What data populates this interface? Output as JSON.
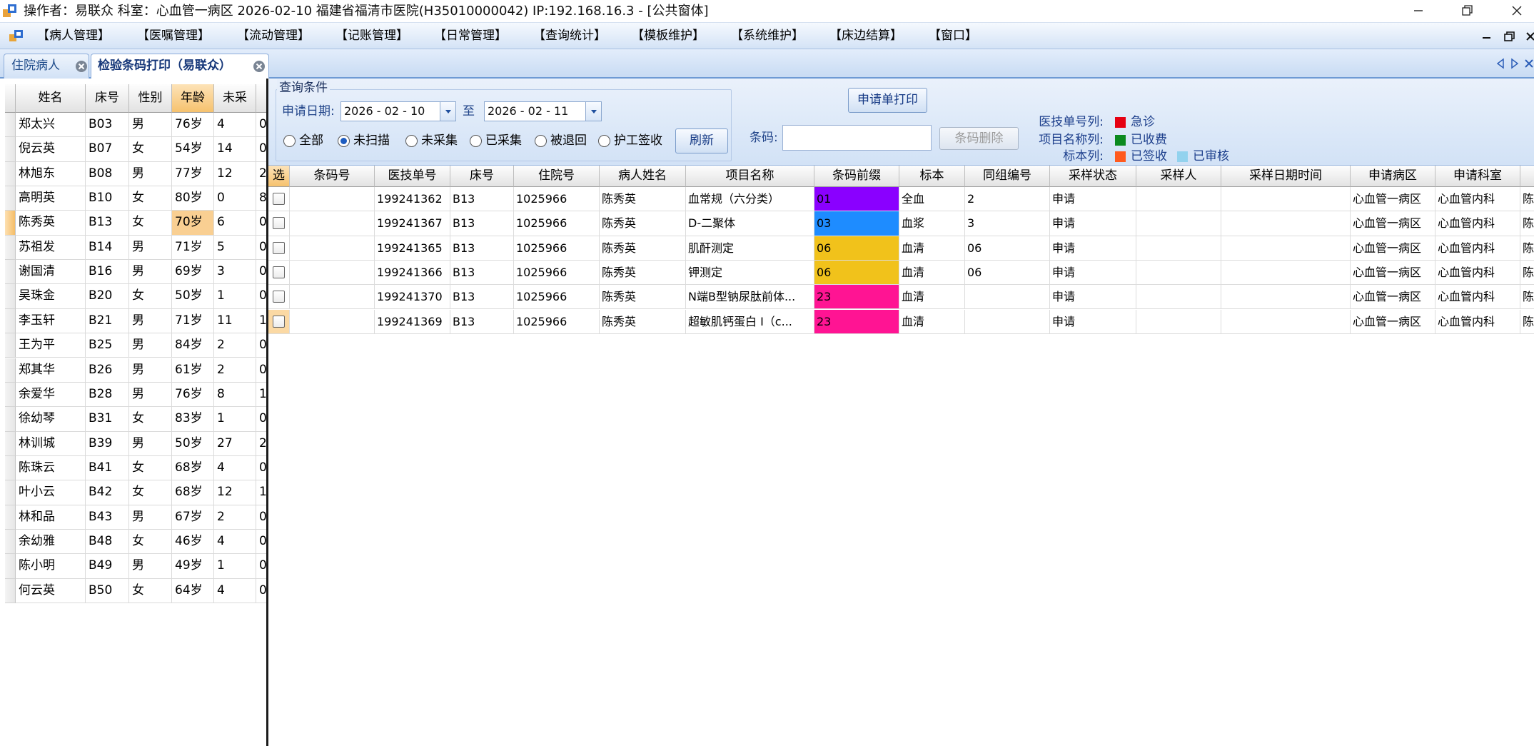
{
  "title_bar": {
    "text": "操作者：易联众  科室：心血管一病区  2026-02-10  福建省福清市医院(H35010000042) IP:192.168.16.3 - [公共窗体]"
  },
  "menu": {
    "items": [
      "【病人管理】",
      "【医嘱管理】",
      "【流动管理】",
      "【记账管理】",
      "【日常管理】",
      "【查询统计】",
      "【模板维护】",
      "【系统维护】",
      "【床边结算】",
      "【窗口】"
    ]
  },
  "tabs": [
    {
      "label": "住院病人",
      "active": false
    },
    {
      "label": "检验条码打印（易联众）",
      "active": true
    }
  ],
  "patient_list": {
    "columns": [
      "姓名",
      "床号",
      "性别",
      "年龄",
      "未采",
      ""
    ],
    "selected_index": 4,
    "rows": [
      {
        "name": "郑太兴",
        "bed": "B03",
        "sex": "男",
        "age": "76岁",
        "pending": "4",
        "extra": "0"
      },
      {
        "name": "倪云英",
        "bed": "B07",
        "sex": "女",
        "age": "54岁",
        "pending": "14",
        "extra": "0"
      },
      {
        "name": "林旭东",
        "bed": "B08",
        "sex": "男",
        "age": "77岁",
        "pending": "12",
        "extra": "2"
      },
      {
        "name": "高明英",
        "bed": "B10",
        "sex": "女",
        "age": "80岁",
        "pending": "0",
        "extra": "8"
      },
      {
        "name": "陈秀英",
        "bed": "B13",
        "sex": "女",
        "age": "70岁",
        "pending": "6",
        "extra": "0"
      },
      {
        "name": "苏祖发",
        "bed": "B14",
        "sex": "男",
        "age": "71岁",
        "pending": "5",
        "extra": "0"
      },
      {
        "name": "谢国清",
        "bed": "B16",
        "sex": "男",
        "age": "69岁",
        "pending": "3",
        "extra": "0"
      },
      {
        "name": "吴珠金",
        "bed": "B20",
        "sex": "女",
        "age": "50岁",
        "pending": "1",
        "extra": "0"
      },
      {
        "name": "李玉轩",
        "bed": "B21",
        "sex": "男",
        "age": "71岁",
        "pending": "11",
        "extra": "1"
      },
      {
        "name": "王为平",
        "bed": "B25",
        "sex": "男",
        "age": "84岁",
        "pending": "2",
        "extra": "0"
      },
      {
        "name": "郑其华",
        "bed": "B26",
        "sex": "男",
        "age": "61岁",
        "pending": "2",
        "extra": "0"
      },
      {
        "name": "余爱华",
        "bed": "B28",
        "sex": "男",
        "age": "76岁",
        "pending": "8",
        "extra": "1"
      },
      {
        "name": "徐幼琴",
        "bed": "B31",
        "sex": "女",
        "age": "83岁",
        "pending": "1",
        "extra": "0"
      },
      {
        "name": "林训城",
        "bed": "B39",
        "sex": "男",
        "age": "50岁",
        "pending": "27",
        "extra": "2"
      },
      {
        "name": "陈珠云",
        "bed": "B41",
        "sex": "女",
        "age": "68岁",
        "pending": "4",
        "extra": "0"
      },
      {
        "name": "叶小云",
        "bed": "B42",
        "sex": "女",
        "age": "68岁",
        "pending": "12",
        "extra": "1"
      },
      {
        "name": "林和品",
        "bed": "B43",
        "sex": "男",
        "age": "67岁",
        "pending": "2",
        "extra": "0"
      },
      {
        "name": "余幼雅",
        "bed": "B48",
        "sex": "女",
        "age": "46岁",
        "pending": "4",
        "extra": "0"
      },
      {
        "name": "陈小明",
        "bed": "B49",
        "sex": "男",
        "age": "49岁",
        "pending": "1",
        "extra": "0"
      },
      {
        "name": "何云英",
        "bed": "B50",
        "sex": "女",
        "age": "64岁",
        "pending": "4",
        "extra": "0"
      }
    ]
  },
  "query": {
    "group_title": "查询条件",
    "date_label": "申请日期:",
    "date_from": "2026 - 02 - 10",
    "to_label": "至",
    "date_to": "2026 - 02 - 11",
    "radios": [
      {
        "label": "全部",
        "checked": false
      },
      {
        "label": "未扫描",
        "checked": true
      },
      {
        "label": "未采集",
        "checked": false
      },
      {
        "label": "已采集",
        "checked": false
      },
      {
        "label": "被退回",
        "checked": false
      },
      {
        "label": "护工签收",
        "checked": false
      }
    ],
    "refresh_label": "刷新",
    "print_label": "申请单打印",
    "barcode_label": "条码:",
    "delete_label": "条码删除"
  },
  "legend": [
    {
      "label": "医技单号列:",
      "items": [
        {
          "color": "#e60012",
          "text": "急诊"
        }
      ]
    },
    {
      "label": "项目名称列:",
      "items": [
        {
          "color": "#0b8a1f",
          "text": "已收费"
        }
      ]
    },
    {
      "label": "标本列:",
      "items": [
        {
          "color": "#ff5a1e",
          "text": "已签收"
        },
        {
          "color": "#92d2ee",
          "text": "已审核"
        }
      ]
    }
  ],
  "grid": {
    "columns": [
      "选",
      "条码号",
      "医技单号",
      "床号",
      "住院号",
      "病人姓名",
      "项目名称",
      "条码前缀",
      "标本",
      "同组编号",
      "采样状态",
      "采样人",
      "采样日期时间",
      "申请病区",
      "申请科室",
      "申"
    ],
    "current_row": 5,
    "rows": [
      {
        "barcode": "",
        "order_no": "199241362",
        "bed": "B13",
        "admission_no": "1025966",
        "patient": "陈秀英",
        "item": "血常规（六分类）",
        "prefix": "01",
        "prefix_color": "#8a00ff",
        "specimen": "全血",
        "group_no": "2",
        "status": "申请",
        "collector": "",
        "collect_time": "",
        "ward": "心血管一病区",
        "dept": "心血管内科",
        "more": "陈"
      },
      {
        "barcode": "",
        "order_no": "199241367",
        "bed": "B13",
        "admission_no": "1025966",
        "patient": "陈秀英",
        "item": "D-二聚体",
        "prefix": "03",
        "prefix_color": "#1e8cff",
        "specimen": "血浆",
        "group_no": "3",
        "status": "申请",
        "collector": "",
        "collect_time": "",
        "ward": "心血管一病区",
        "dept": "心血管内科",
        "more": "陈"
      },
      {
        "barcode": "",
        "order_no": "199241365",
        "bed": "B13",
        "admission_no": "1025966",
        "patient": "陈秀英",
        "item": "肌酐测定",
        "prefix": "06",
        "prefix_color": "#f1c21b",
        "specimen": "血清",
        "group_no": "06",
        "status": "申请",
        "collector": "",
        "collect_time": "",
        "ward": "心血管一病区",
        "dept": "心血管内科",
        "more": "陈"
      },
      {
        "barcode": "",
        "order_no": "199241366",
        "bed": "B13",
        "admission_no": "1025966",
        "patient": "陈秀英",
        "item": "钾测定",
        "prefix": "06",
        "prefix_color": "#f1c21b",
        "specimen": "血清",
        "group_no": "06",
        "status": "申请",
        "collector": "",
        "collect_time": "",
        "ward": "心血管一病区",
        "dept": "心血管内科",
        "more": "陈"
      },
      {
        "barcode": "",
        "order_no": "199241370",
        "bed": "B13",
        "admission_no": "1025966",
        "patient": "陈秀英",
        "item": "N端B型钠尿肽前体...",
        "prefix": "23",
        "prefix_color": "#ff1493",
        "specimen": "血清",
        "group_no": "",
        "status": "申请",
        "collector": "",
        "collect_time": "",
        "ward": "心血管一病区",
        "dept": "心血管内科",
        "more": "陈"
      },
      {
        "barcode": "",
        "order_no": "199241369",
        "bed": "B13",
        "admission_no": "1025966",
        "patient": "陈秀英",
        "item": "超敏肌钙蛋白 I（c...",
        "prefix": "23",
        "prefix_color": "#ff1493",
        "specimen": "血清",
        "group_no": "",
        "status": "申请",
        "collector": "",
        "collect_time": "",
        "ward": "心血管一病区",
        "dept": "心血管内科",
        "more": "陈"
      }
    ]
  }
}
